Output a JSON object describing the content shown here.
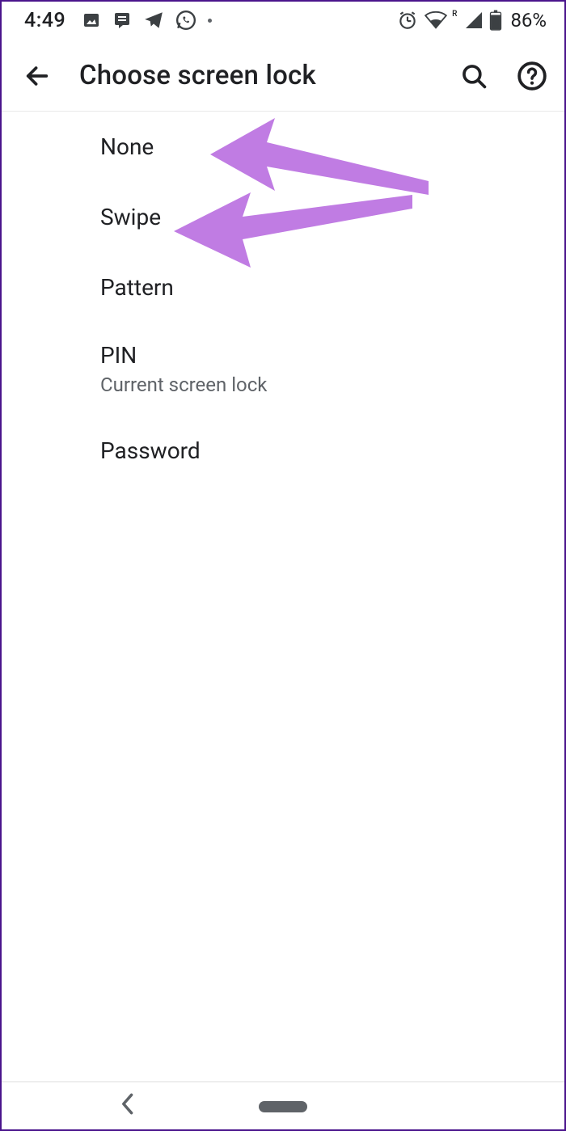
{
  "status": {
    "time": "4:49",
    "battery": "86%",
    "wifi_label": "R"
  },
  "toolbar": {
    "title": "Choose screen lock"
  },
  "options": {
    "none": {
      "label": "None"
    },
    "swipe": {
      "label": "Swipe"
    },
    "pattern": {
      "label": "Pattern"
    },
    "pin": {
      "label": "PIN",
      "sub": "Current screen lock"
    },
    "password": {
      "label": "Password"
    }
  },
  "colors": {
    "annotation": "#c07ce3"
  }
}
